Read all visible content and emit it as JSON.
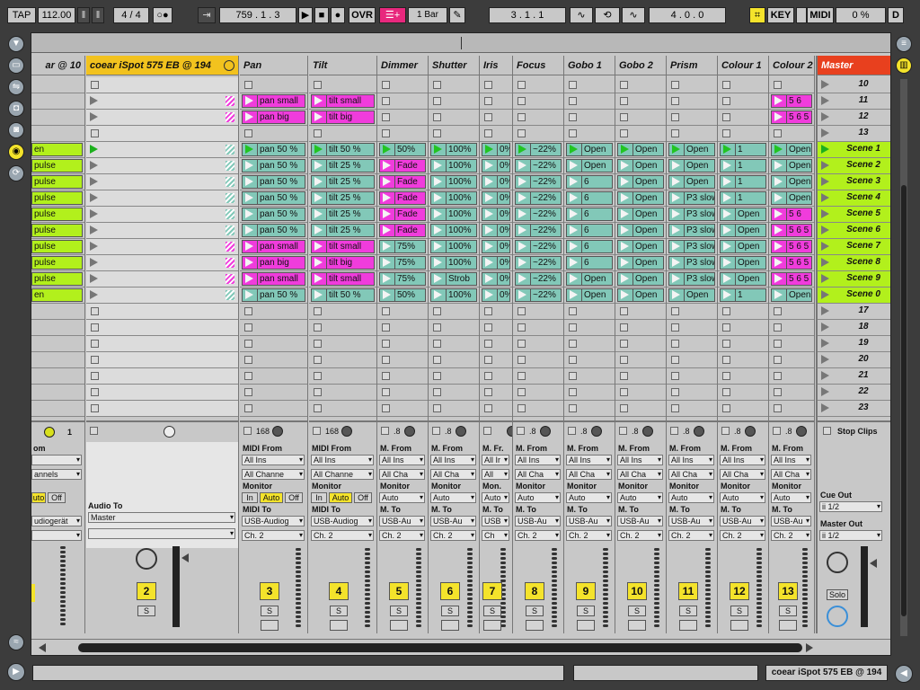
{
  "transport": {
    "tap": "TAP",
    "tempo": "112.00",
    "signature_num": "4",
    "signature_den": "4",
    "position": "759 . 1 . 3",
    "ovr": "OVR",
    "quantize": "1 Bar",
    "loop_start": "3 . 1 . 1",
    "loop_length": "4 . 0 . 0",
    "key": "KEY",
    "midi": "MIDI",
    "cpu": "0 %",
    "d": "D"
  },
  "colors": {
    "green": "#b2f01c",
    "teal": "#82c8b8",
    "pink": "#f03cdc",
    "yellow": "#f4e32b",
    "selected_header": "#f2c21e",
    "master_header": "#e8401e"
  },
  "partial_column": {
    "title": "ar @ 10",
    "slots": [
      "",
      "",
      "",
      "",
      "en",
      "pulse",
      "pulse",
      "pulse",
      "pulse",
      "pulse",
      "pulse",
      "pulse",
      "pulse",
      "en"
    ],
    "from_label": "om",
    "chan_value": "annels",
    "auto": "uto",
    "off": "Off",
    "out_value": "udiogerät",
    "num": "1"
  },
  "selected_column": {
    "title": "coear iSpot 575 EB @ 194",
    "audio_to_label": "Audio To",
    "audio_to_value": "Master",
    "track_num": "2",
    "solo": "S"
  },
  "columns": [
    {
      "title": "Pan",
      "num": "3",
      "volume": "168",
      "from_label": "MIDI From",
      "from_value": "All Ins",
      "chan_value": "All Channe",
      "monitor_label": "Monitor",
      "to_label": "MIDI To",
      "to_value": "USB-Audiog",
      "ch_value": "Ch. 2",
      "monitor_full": true,
      "clips": [
        "",
        "pan small",
        "pan big",
        "",
        "pan 50 %",
        "pan 50 %",
        "pan 50 %",
        "pan 50 %",
        "pan 50 %",
        "pan 50 %",
        "pan small",
        "pan big",
        "pan small",
        "pan 50 %"
      ],
      "colors": [
        "",
        "pink",
        "pink",
        "",
        "teal",
        "teal",
        "teal",
        "teal",
        "teal",
        "teal",
        "pink",
        "pink",
        "pink",
        "teal"
      ]
    },
    {
      "title": "Tilt",
      "num": "4",
      "volume": "168",
      "from_label": "MIDI From",
      "from_value": "All Ins",
      "chan_value": "All Channe",
      "monitor_label": "Monitor",
      "to_label": "MIDI To",
      "to_value": "USB-Audiog",
      "ch_value": "Ch. 2",
      "monitor_full": true,
      "clips": [
        "",
        "tilt small",
        "tilt big",
        "",
        "tilt 50 %",
        "tilt 25 %",
        "tilt 25 %",
        "tilt 25 %",
        "tilt 25 %",
        "tilt 25 %",
        "tilt small",
        "tilt big",
        "tilt small",
        "tilt 50 %"
      ],
      "colors": [
        "",
        "pink",
        "pink",
        "",
        "teal",
        "teal",
        "teal",
        "teal",
        "teal",
        "teal",
        "pink",
        "pink",
        "pink",
        "teal"
      ]
    },
    {
      "title": "Dimmer",
      "num": "5",
      "volume": ".8",
      "from_label": "M. From",
      "from_value": "All Ins",
      "chan_value": "All Cha",
      "monitor_label": "Monitor",
      "to_label": "M. To",
      "to_value": "USB-Au",
      "ch_value": "Ch. 2",
      "monitor_full": false,
      "clips": [
        "",
        "",
        "",
        "",
        "50%",
        "Fade",
        "Fade",
        "Fade",
        "Fade",
        "Fade",
        "75%",
        "75%",
        "75%",
        "50%"
      ],
      "colors": [
        "",
        "",
        "",
        "",
        "teal",
        "pink",
        "pink",
        "pink",
        "pink",
        "pink",
        "teal",
        "teal",
        "teal",
        "teal"
      ]
    },
    {
      "title": "Shutter",
      "num": "6",
      "volume": ".8",
      "from_label": "M. From",
      "from_value": "All Ins",
      "chan_value": "All Cha",
      "monitor_label": "Monitor",
      "to_label": "M. To",
      "to_value": "USB-Au",
      "ch_value": "Ch. 2",
      "monitor_full": false,
      "clips": [
        "",
        "",
        "",
        "",
        "100%",
        "100%",
        "100%",
        "100%",
        "100%",
        "100%",
        "100%",
        "100%",
        "Strob",
        "100%"
      ],
      "colors": [
        "",
        "",
        "",
        "",
        "teal",
        "teal",
        "teal",
        "teal",
        "teal",
        "teal",
        "teal",
        "teal",
        "teal",
        "teal"
      ]
    },
    {
      "title": "Iris",
      "num": "7",
      "volume": "",
      "from_label": "M. Fr.",
      "from_value": "All Ir",
      "chan_value": "All",
      "monitor_label": "Mon.",
      "to_label": "M. To",
      "to_value": "USB",
      "ch_value": "Ch",
      "monitor_full": false,
      "clips": [
        "",
        "",
        "",
        "",
        "0%",
        "0%",
        "0%",
        "0%",
        "0%",
        "0%",
        "0%",
        "0%",
        "0%",
        "0%"
      ],
      "colors": [
        "",
        "",
        "",
        "",
        "teal",
        "teal",
        "teal",
        "teal",
        "teal",
        "teal",
        "teal",
        "teal",
        "teal",
        "teal"
      ]
    },
    {
      "title": "Focus",
      "num": "8",
      "volume": ".8",
      "from_label": "M. From",
      "from_value": "All Ins",
      "chan_value": "All Cha",
      "monitor_label": "Monitor",
      "to_label": "M. To",
      "to_value": "USB-Au",
      "ch_value": "Ch. 2",
      "monitor_full": false,
      "clips": [
        "",
        "",
        "",
        "",
        "~22%",
        "~22%",
        "~22%",
        "~22%",
        "~22%",
        "~22%",
        "~22%",
        "~22%",
        "~22%",
        "~22%"
      ],
      "colors": [
        "",
        "",
        "",
        "",
        "teal",
        "teal",
        "teal",
        "teal",
        "teal",
        "teal",
        "teal",
        "teal",
        "teal",
        "teal"
      ]
    },
    {
      "title": "Gobo 1",
      "num": "9",
      "volume": ".8",
      "from_label": "M. From",
      "from_value": "All Ins",
      "chan_value": "All Cha",
      "monitor_label": "Monitor",
      "to_label": "M. To",
      "to_value": "USB-Au",
      "ch_value": "Ch. 2",
      "monitor_full": false,
      "clips": [
        "",
        "",
        "",
        "",
        "Open",
        "Open",
        "6",
        "6",
        "6",
        "6",
        "6",
        "6",
        "Open",
        "Open"
      ],
      "colors": [
        "",
        "",
        "",
        "",
        "teal",
        "teal",
        "teal",
        "teal",
        "teal",
        "teal",
        "teal",
        "teal",
        "teal",
        "teal"
      ]
    },
    {
      "title": "Gobo 2",
      "num": "10",
      "volume": ".8",
      "from_label": "M. From",
      "from_value": "All Ins",
      "chan_value": "All Cha",
      "monitor_label": "Monitor",
      "to_label": "M. To",
      "to_value": "USB-Au",
      "ch_value": "Ch. 2",
      "monitor_full": false,
      "clips": [
        "",
        "",
        "",
        "",
        "Open",
        "Open",
        "Open",
        "Open",
        "Open",
        "Open",
        "Open",
        "Open",
        "Open",
        "Open"
      ],
      "colors": [
        "",
        "",
        "",
        "",
        "teal",
        "teal",
        "teal",
        "teal",
        "teal",
        "teal",
        "teal",
        "teal",
        "teal",
        "teal"
      ]
    },
    {
      "title": "Prism",
      "num": "11",
      "volume": ".8",
      "from_label": "M. From",
      "from_value": "All Ins",
      "chan_value": "All Cha",
      "monitor_label": "Monitor",
      "to_label": "M. To",
      "to_value": "USB-Au",
      "ch_value": "Ch. 2",
      "monitor_full": false,
      "clips": [
        "",
        "",
        "",
        "",
        "Open",
        "Open",
        "Open",
        "P3 slow",
        "P3 slow",
        "P3 slow",
        "P3 slow",
        "P3 slow",
        "P3 slow",
        "Open"
      ],
      "colors": [
        "",
        "",
        "",
        "",
        "teal",
        "teal",
        "teal",
        "teal",
        "teal",
        "teal",
        "teal",
        "teal",
        "teal",
        "teal"
      ]
    },
    {
      "title": "Colour 1",
      "num": "12",
      "volume": ".8",
      "from_label": "M. From",
      "from_value": "All Ins",
      "chan_value": "All Cha",
      "monitor_label": "Monitor",
      "to_label": "M. To",
      "to_value": "USB-Au",
      "ch_value": "Ch. 2",
      "monitor_full": false,
      "clips": [
        "",
        "",
        "",
        "",
        "1",
        "1",
        "1",
        "1",
        "Open",
        "Open",
        "Open",
        "Open",
        "Open",
        "1"
      ],
      "colors": [
        "",
        "",
        "",
        "",
        "teal",
        "teal",
        "teal",
        "teal",
        "teal",
        "teal",
        "teal",
        "teal",
        "teal",
        "teal"
      ]
    },
    {
      "title": "Colour 2",
      "num": "13",
      "volume": ".8",
      "from_label": "M. From",
      "from_value": "All Ins",
      "chan_value": "All Cha",
      "monitor_label": "Monitor",
      "to_label": "M. To",
      "to_value": "USB-Au",
      "ch_value": "Ch. 2",
      "monitor_full": false,
      "clips": [
        "",
        "5 6",
        "5 6 5 6",
        "",
        "Open",
        "Open",
        "Open",
        "Open",
        "5 6",
        "5 6 5 6",
        "5 6 5 6",
        "5 6 5 6",
        "5 6 5 6",
        "Open"
      ],
      "colors": [
        "",
        "pink",
        "pink",
        "",
        "teal",
        "teal",
        "teal",
        "teal",
        "pink",
        "pink",
        "pink",
        "pink",
        "pink",
        "teal"
      ]
    }
  ],
  "master": {
    "title": "Master",
    "scenes": [
      "10",
      "11",
      "12",
      "13",
      "Scene 1",
      "Scene 2",
      "Scene 3",
      "Scene 4",
      "Scene 5",
      "Scene 6",
      "Scene 7",
      "Scene 8",
      "Scene 9",
      "Scene 0",
      "17",
      "18",
      "19",
      "20",
      "21",
      "22",
      "23"
    ],
    "stop_clips": "Stop Clips",
    "cue_out_label": "Cue Out",
    "cue_out_value": "ii 1/2",
    "master_out_label": "Master Out",
    "master_out_value": "ii 1/2",
    "solo": "Solo"
  },
  "monitor": {
    "in": "In",
    "auto": "Auto",
    "off": "Off"
  },
  "track_controls": {
    "solo": "S"
  },
  "status": {
    "selected_track": "coear iSpot 575 EB @ 194"
  }
}
